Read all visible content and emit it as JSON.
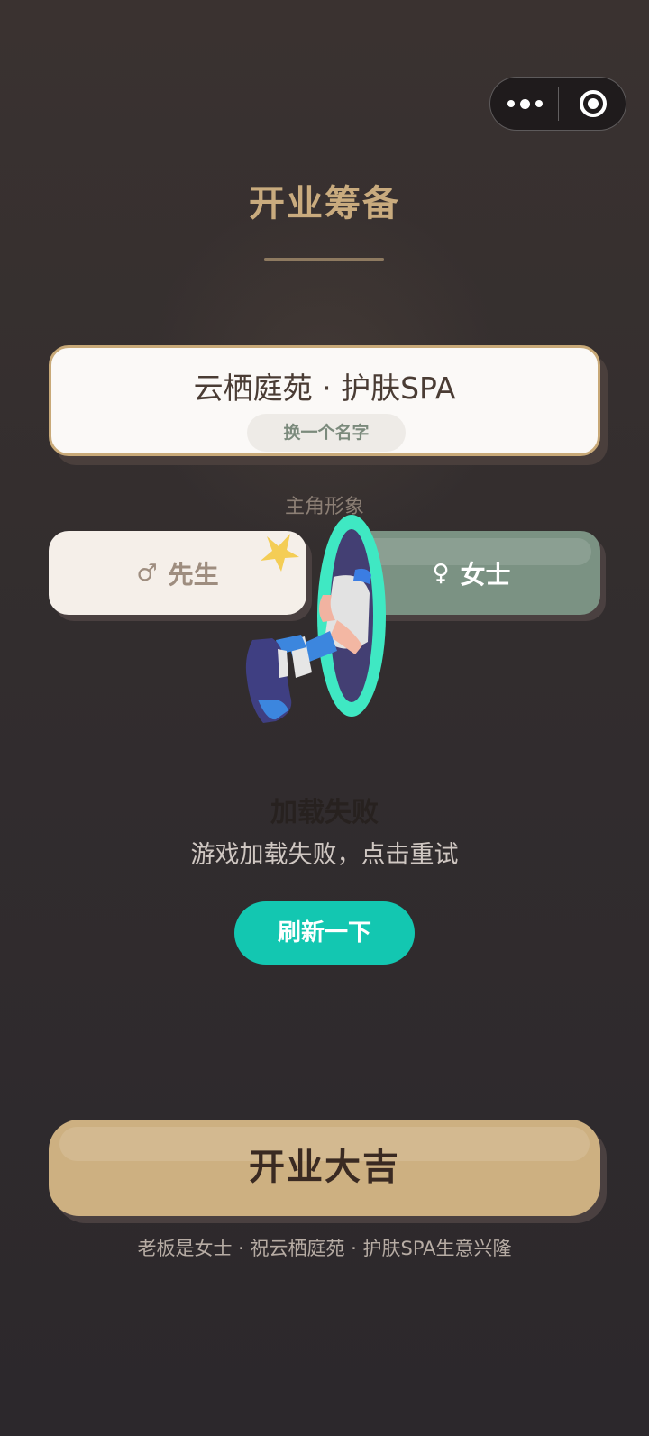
{
  "header": {
    "title": "开业筹备"
  },
  "capsule": {
    "more_icon": "more-dots-icon",
    "close_icon": "target-close-icon"
  },
  "name_card": {
    "shop_name": "云栖庭苑 · 护肤SPA",
    "change_label": "换一个名字"
  },
  "gender": {
    "label": "主角形象",
    "male": {
      "symbol": "♂",
      "label": "先生"
    },
    "female": {
      "symbol": "♀",
      "label": "女士"
    },
    "selected": "female"
  },
  "error": {
    "title": "加载失败",
    "message": "游戏加载失败，点击重试",
    "retry_label": "刷新一下",
    "illustration_icon": "portal-legs-icon"
  },
  "cta": {
    "label": "开业大吉"
  },
  "footer": {
    "blessing": "老板是女士 · 祝云栖庭苑 · 护肤SPA生意兴隆"
  },
  "colors": {
    "accent_gold": "#c9ab7e",
    "button_gold": "#cdb081",
    "teal": "#13c7b1",
    "sage": "#7b9283"
  }
}
